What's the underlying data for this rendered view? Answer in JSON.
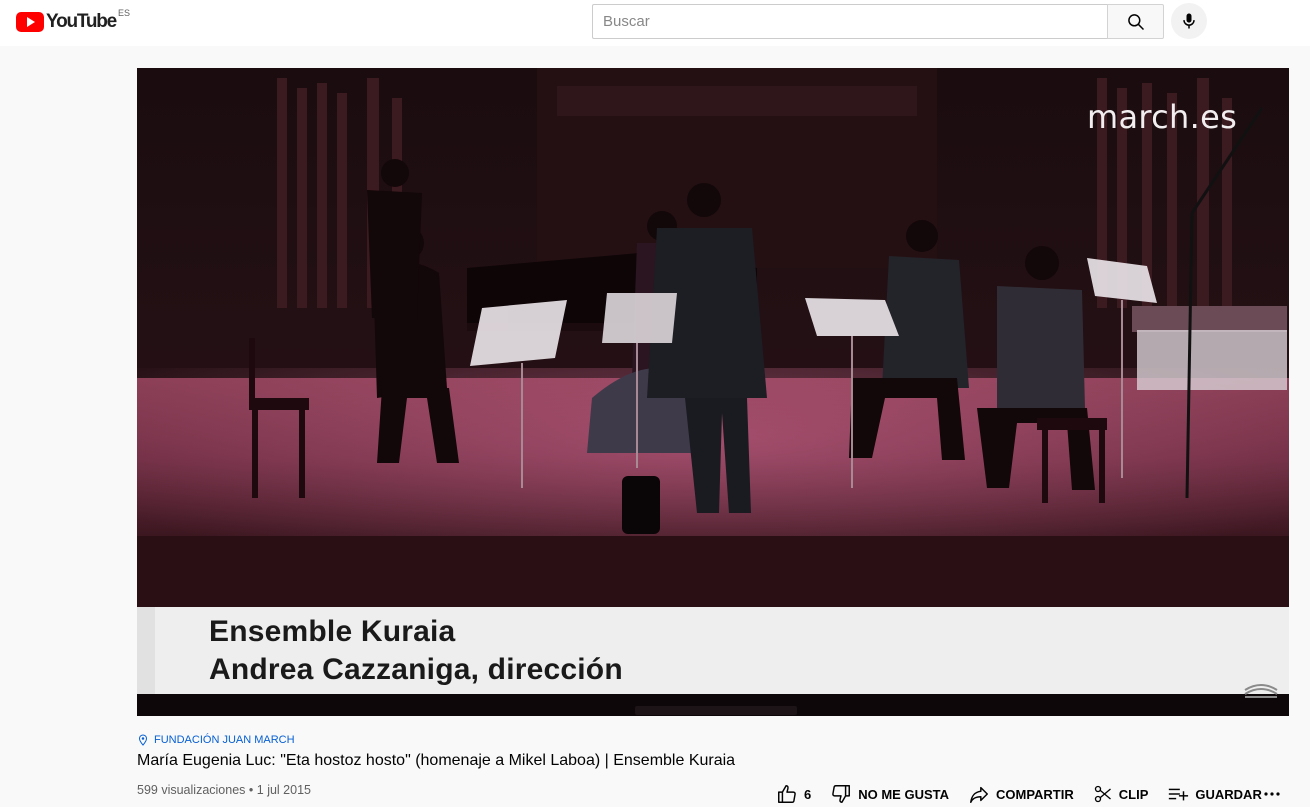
{
  "masthead": {
    "logo_text": "YouTube",
    "country_code": "ES",
    "search_placeholder": "Buscar"
  },
  "player": {
    "watermark": "march.es",
    "caption_line1": "Ensemble Kuraia",
    "caption_line2": "Andrea Cazzaniga, dirección"
  },
  "video": {
    "channel_tag": "FUNDACIÓN JUAN MARCH",
    "title": "María Eugenia Luc: \"Eta hostoz hosto\" (homenaje a Mikel Laboa) | Ensemble Kuraia",
    "views": "599 visualizaciones",
    "separator": "•",
    "date": "1 jul 2015"
  },
  "actions": {
    "like_count": "6",
    "dislike_label": "NO ME GUSTA",
    "share_label": "COMPARTIR",
    "clip_label": "CLIP",
    "save_label": "GUARDAR"
  },
  "icons": {
    "logo": "youtube-logo-icon",
    "search": "search-icon",
    "mic": "microphone-icon",
    "location": "location-pin-icon",
    "like": "thumbs-up-icon",
    "dislike": "thumbs-down-icon",
    "share": "share-arrow-icon",
    "clip": "scissors-icon",
    "save": "add-to-playlist-icon",
    "more": "more-horizontal-icon"
  },
  "colors": {
    "brand_red": "#ff0000",
    "link_blue": "#065fd4",
    "stage_pink": "#b04a74"
  }
}
